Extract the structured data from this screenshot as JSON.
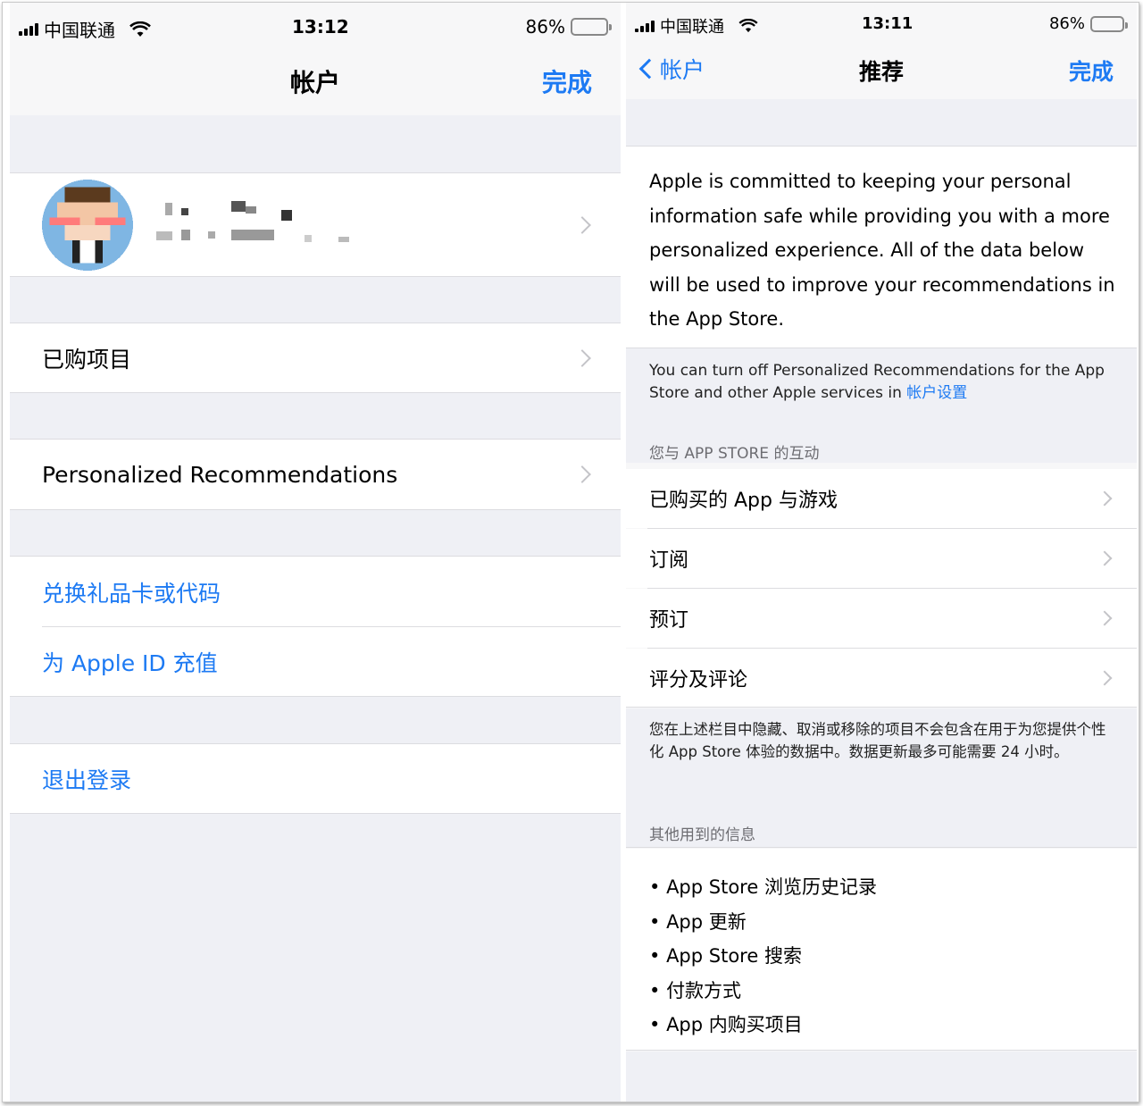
{
  "left": {
    "status": {
      "carrier": "中国联通",
      "time": "13:12",
      "battery": "86%",
      "battery_level": 0.86
    },
    "nav": {
      "title": "帐户",
      "done": "完成"
    },
    "profile": {
      "name": "",
      "email": ""
    },
    "items": {
      "purchased": "已购项目",
      "personalized": "Personalized Recommendations",
      "redeem": "兑换礼品卡或代码",
      "add_funds": "为 Apple ID 充值",
      "sign_out": "退出登录"
    }
  },
  "right": {
    "status": {
      "carrier": "中国联通",
      "time": "13:11",
      "battery": "86%",
      "battery_level": 0.86
    },
    "nav": {
      "back": "帐户",
      "title": "推荐",
      "done": "完成"
    },
    "intro": "Apple is committed to keeping your personal information safe while providing you with a more personalized experience. All of the data below will be used to improve your recommendations in the App Store.",
    "turn_off_note": "You can turn off Personalized Recommendations for the App Store and other Apple services in",
    "turn_off_link": "帐户设置",
    "section1_header": "您与 APP STORE 的互动",
    "rows": [
      "已购买的 App 与游戏",
      "订阅",
      "预订",
      "评分及评论"
    ],
    "hidden_note": "您在上述栏目中隐藏、取消或移除的项目不会包含在用于为您提供个性化 App Store 体验的数据中。数据更新最多可能需要 24 小时。",
    "section2_header": "其他用到的信息",
    "bullets": [
      "App Store 浏览历史记录",
      "App 更新",
      "App Store 搜索",
      "付款方式",
      "App 内购买项目"
    ]
  },
  "colors": {
    "accent": "#1d7af3",
    "battery": "#f5c400",
    "grouped_bg": "#eff0f5"
  }
}
